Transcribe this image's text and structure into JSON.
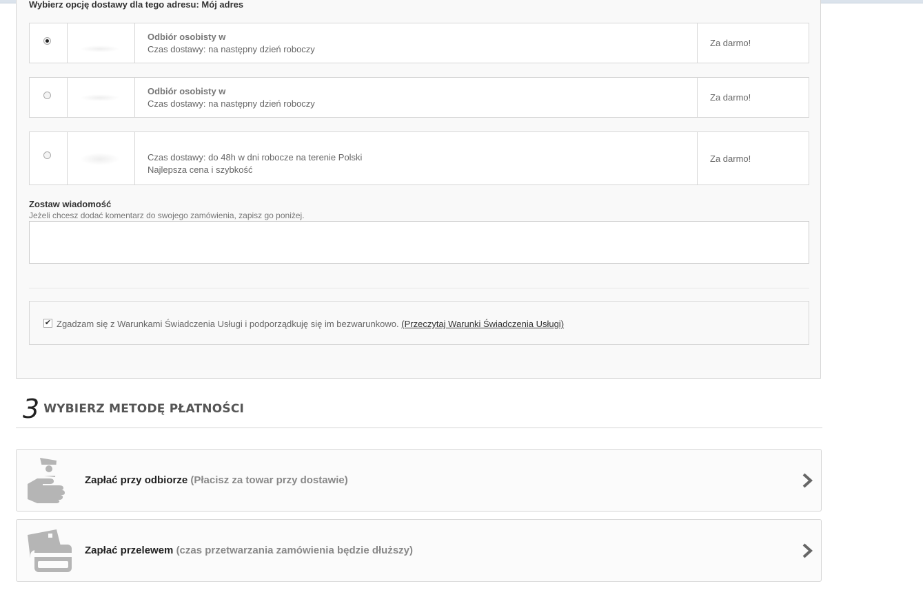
{
  "delivery": {
    "heading": "Wybierz opcję dostawy dla tego adresu: Mój adres",
    "options": [
      {
        "name": "Odbiór osobisty w",
        "time": "Czas dostawy: na następny dzień roboczy",
        "extra": "",
        "price": "Za darmo!",
        "selected": true
      },
      {
        "name": "Odbiór osobisty w",
        "time": "Czas dostawy: na następny dzień roboczy",
        "extra": "",
        "price": "Za darmo!",
        "selected": false
      },
      {
        "name": "",
        "time": "Czas dostawy: do 48h w dni robocze na terenie Polski",
        "extra": "Najlepsza cena i szybkość",
        "price": "Za darmo!",
        "selected": false
      }
    ]
  },
  "message": {
    "title": "Zostaw wiadomość",
    "hint": "Jeżeli chcesz dodać komentarz do swojego zamówienia, zapisz go poniżej.",
    "value": ""
  },
  "terms": {
    "checked": true,
    "text": "Zgadzam się z Warunkami Świadczenia Usługi i podporządkuję się im bezwarunkowo.",
    "link": "(Przeczytaj Warunki Świadczenia Usługi)"
  },
  "payment": {
    "step_number": "3",
    "title": "WYBIERZ METODĘ PŁATNOŚCI",
    "options": [
      {
        "label": "Zapłać przy odbiorze",
        "note": "(Płacisz za towar przy dostawie)",
        "icon": "cash-hand-icon"
      },
      {
        "label": "Zapłać przelewem",
        "note": "(czas przetwarzania zamówienia będzie dłuższy)",
        "icon": "credit-card-icon"
      }
    ]
  },
  "colors": {
    "panel_bg": "#f9f9f9",
    "border": "#d6d6d6",
    "icon_gray": "#b5b5b5"
  }
}
